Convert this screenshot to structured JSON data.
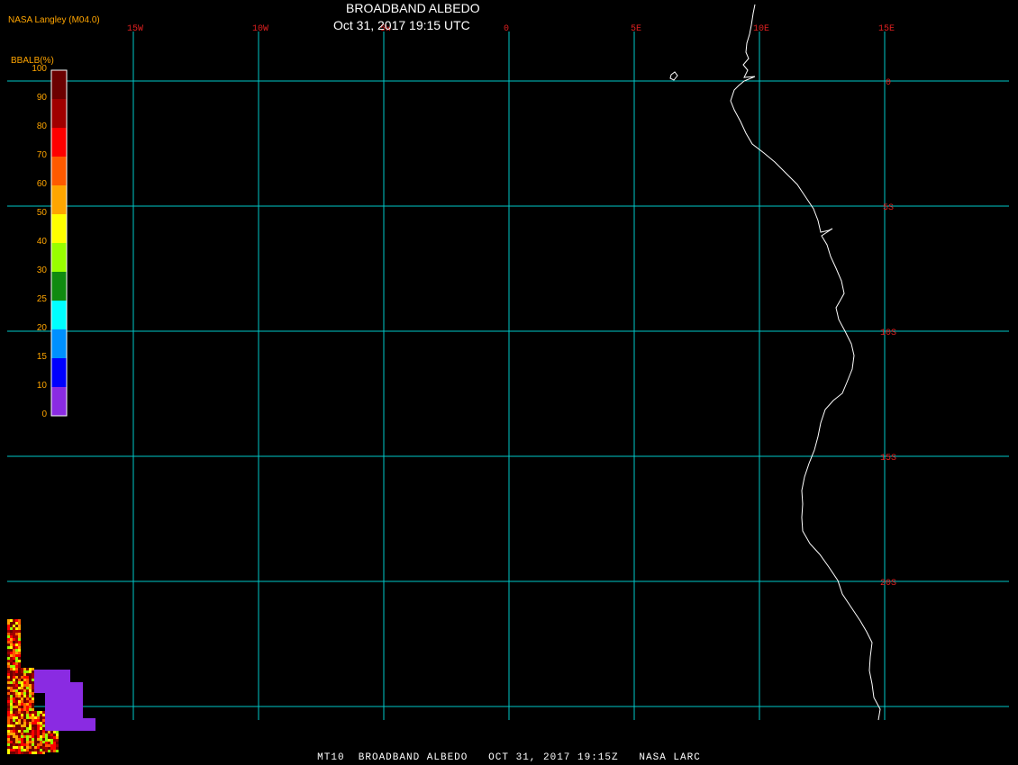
{
  "title": "BROADBAND ALBEDO",
  "datetime": "Oct 31, 2017 19:15 UTC",
  "credit": "NASA Langley (M04.0)",
  "footer": "MT10  BROADBAND ALBEDO   OCT 31, 2017 19:15Z   NASA LARC",
  "colorbar": {
    "title": "BBALB(%)",
    "ticks": [
      "100",
      "90",
      "80",
      "70",
      "60",
      "50",
      "40",
      "30",
      "25",
      "20",
      "15",
      "10",
      "0"
    ],
    "colors": [
      "#6b0000",
      "#a00000",
      "#ff0000",
      "#ff5a00",
      "#ffa500",
      "#ffff00",
      "#98ff00",
      "#108a10",
      "#00ffff",
      "#0090ff",
      "#0000ff",
      "#8a2be2"
    ]
  },
  "map": {
    "longitude_labels": [
      "15W",
      "10W",
      "5W",
      "0",
      "5E",
      "10E",
      "15E"
    ],
    "latitude_labels": [
      "0",
      "5S",
      "10S",
      "15S",
      "20S"
    ],
    "grid_color": "#00c8c8",
    "label_color": "#e02020",
    "coast_color": "#ffffff"
  }
}
